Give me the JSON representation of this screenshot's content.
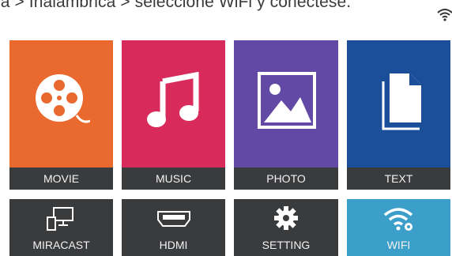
{
  "caption": "ia > Inalámbrica > seleccione WiFi y conéctese.",
  "tiles": [
    {
      "label": "MOVIE",
      "icon": "film-reel-icon",
      "color": "#e9692f"
    },
    {
      "label": "MUSIC",
      "icon": "music-note-icon",
      "color": "#d92b5b"
    },
    {
      "label": "PHOTO",
      "icon": "photo-icon",
      "color": "#6249a6"
    },
    {
      "label": "TEXT",
      "icon": "document-icon",
      "color": "#1b4f9a"
    },
    {
      "label": "MIRACAST",
      "icon": "screen-mirror-icon",
      "color": "#3a3b3d"
    },
    {
      "label": "HDMI",
      "icon": "hdmi-icon",
      "color": "#3a3b3d"
    },
    {
      "label": "SETTING",
      "icon": "gear-icon",
      "color": "#3a3b3d"
    },
    {
      "label": "WIFI",
      "icon": "wifi-icon",
      "color": "#3b9fc9"
    }
  ],
  "status_icon": "wifi-signal-icon"
}
